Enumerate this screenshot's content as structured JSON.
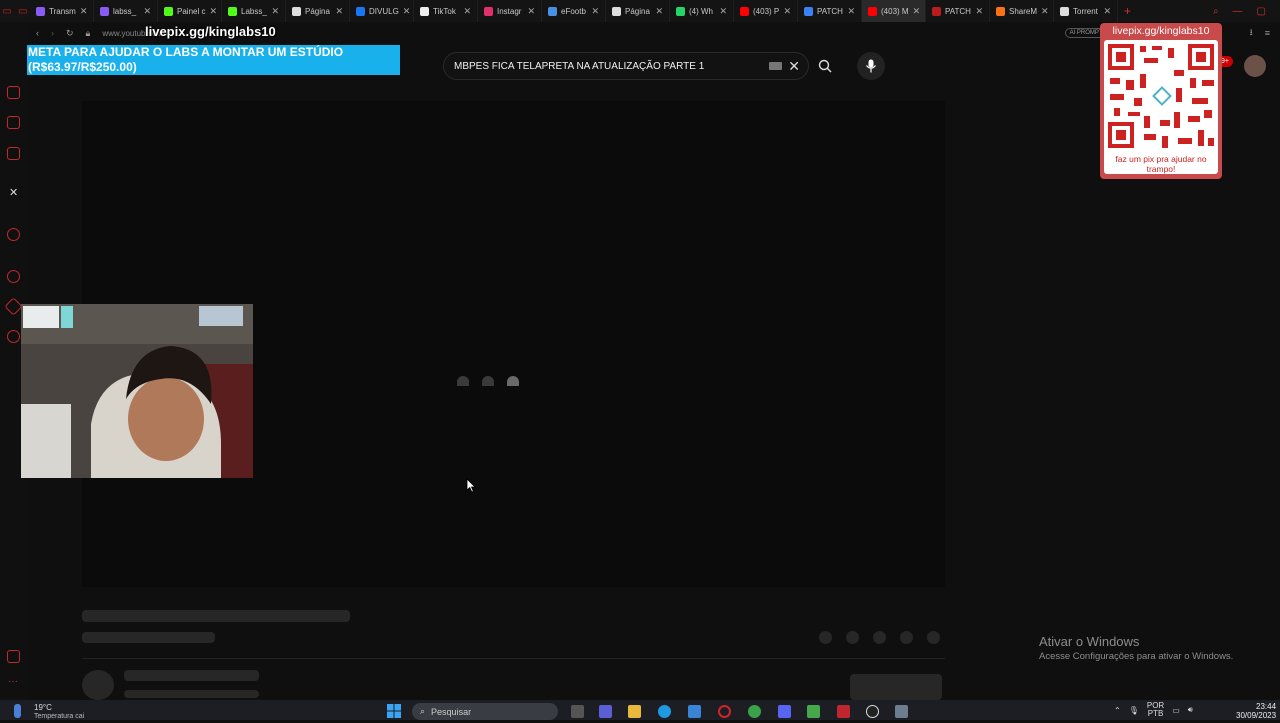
{
  "browser": {
    "tabs": [
      {
        "label": "Transm",
        "color": "#8a5cf6"
      },
      {
        "label": "labss_",
        "color": "#8a5cf6"
      },
      {
        "label": "Painel c",
        "color": "#53fc18"
      },
      {
        "label": "Labss_",
        "color": "#53fc18"
      },
      {
        "label": "Página",
        "color": "#dddddd"
      },
      {
        "label": "DIVULG",
        "color": "#1877f2"
      },
      {
        "label": "TikTok",
        "color": "#eeeeee"
      },
      {
        "label": "Instagr",
        "color": "#e1306c"
      },
      {
        "label": "eFootb",
        "color": "#4a90e2"
      },
      {
        "label": "Página",
        "color": "#dddddd"
      },
      {
        "label": "(4) Wh",
        "color": "#25d366"
      },
      {
        "label": "(403) P",
        "color": "#ff0000"
      },
      {
        "label": "PATCH",
        "color": "#3b82f6"
      },
      {
        "label": "(403) M",
        "color": "#ff0000",
        "active": true
      },
      {
        "label": "PATCH",
        "color": "#b91c1c"
      },
      {
        "label": "ShareM",
        "color": "#f97316"
      },
      {
        "label": "Torrent",
        "color": "#dddddd"
      }
    ],
    "url": "www.youtube.com",
    "ai_prompt_label": "AI PROMPT"
  },
  "overlay": {
    "livepix_handle": "livepix.gg/kinglabs10",
    "goal_line1": "META PARA AJUDAR O LABS A MONTAR UM ESTÚDIO",
    "goal_line2": "(R$63.97/R$250.00)",
    "goal_current": 63.97,
    "goal_target": 250.0,
    "qr_title": "livepix.gg/kinglabs10",
    "qr_caption": "faz um pix pra ajudar no trampo!"
  },
  "youtube": {
    "search_query": "MBPES FICA TELAPRETA NA ATUALIZAÇÃO PARTE 1",
    "notification_count": "9+"
  },
  "windows": {
    "activate_title": "Ativar o Windows",
    "activate_sub": "Acesse Configurações para ativar o Windows.",
    "weather_temp": "19°C",
    "weather_desc": "Temperatura cai",
    "search_placeholder": "Pesquisar",
    "lang": "POR",
    "lang2": "PTB",
    "time": "23:44",
    "date": "30/09/2023"
  },
  "icons": {
    "sidebar": [
      "opera-icon",
      "bag-icon",
      "twitch-icon",
      "instagram-icon",
      "x-icon",
      "player-icon",
      "history-icon",
      "cube-icon",
      "settings-icon",
      "gallery-icon",
      "more-icon"
    ]
  }
}
